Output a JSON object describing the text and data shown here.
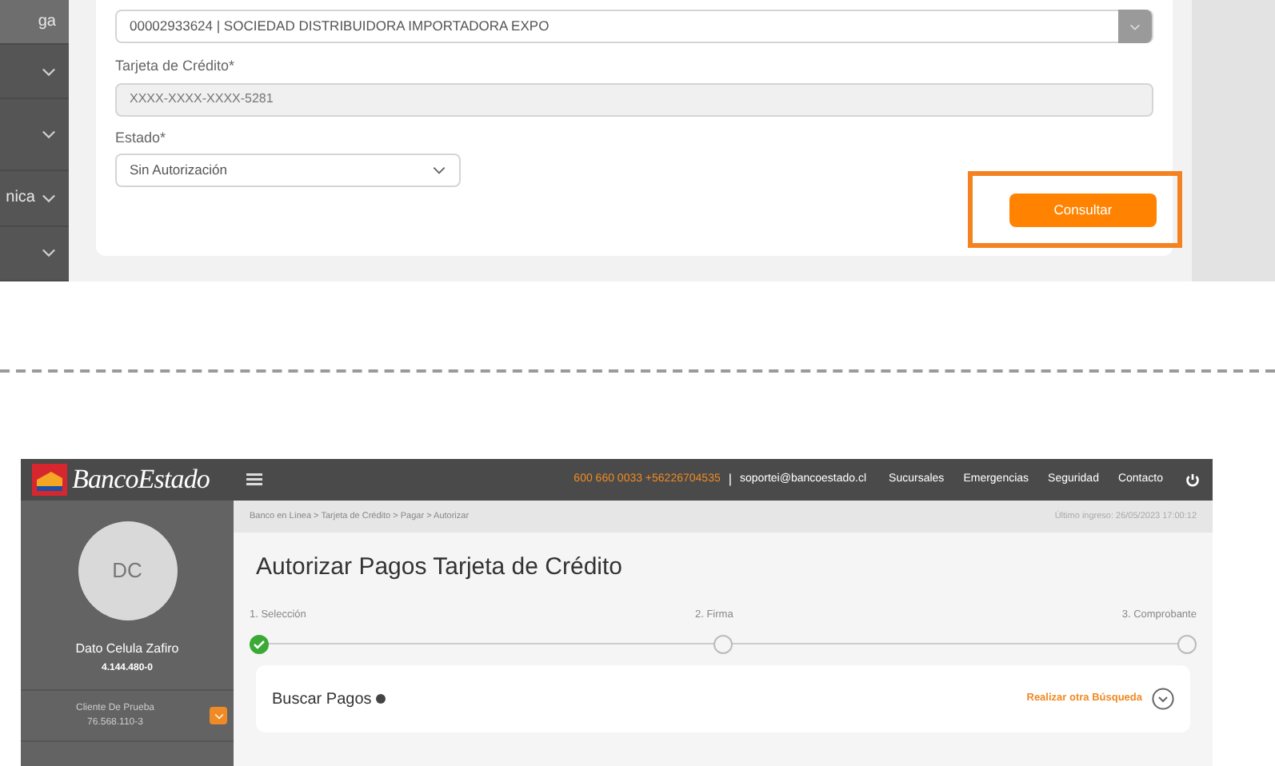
{
  "top_panel": {
    "sidebar_items": [
      {
        "label": "ga",
        "selected": true,
        "expandable": false
      },
      {
        "selected": false,
        "expandable": true
      },
      {
        "selected": false,
        "expandable": true
      },
      {
        "label": "nica",
        "selected": false,
        "expandable": true
      },
      {
        "selected": false,
        "expandable": true
      }
    ],
    "account_select": {
      "value": "00002933624 | SOCIEDAD DISTRIBUIDORA IMPORTADORA EXPO"
    },
    "card_field": {
      "label": "Tarjeta de Crédito*",
      "value": "XXXX-XXXX-XXXX-5281",
      "disabled": true
    },
    "status_select": {
      "label": "Estado*",
      "value": "Sin Autorización"
    },
    "submit_button": {
      "label": "Consultar",
      "highlighted": true
    }
  },
  "bottom_panel": {
    "header": {
      "logo": "BancoEstado",
      "phone": "600 660 0033 +56226704535",
      "separator": "|",
      "email": "soportei@bancoestado.cl",
      "links": [
        "Sucursales",
        "Emergencias",
        "Seguridad",
        "Contacto"
      ]
    },
    "sidebar": {
      "initials": "DC",
      "user_name": "Dato Celula Zafiro",
      "user_rut": "4.144.480-0",
      "client_name": "Cliente De Prueba",
      "client_rut": "76.568.110-3"
    },
    "breadcrumb": "Banco en Línea > Tarjeta de Crédito > Pagar > Autorizar",
    "last_login": "Último ingreso: 26/05/2023 17:00:12",
    "title": "Autorizar Pagos Tarjeta de Crédito",
    "steps": [
      {
        "label": "1. Selección",
        "done": true
      },
      {
        "label": "2. Firma",
        "done": false
      },
      {
        "label": "3. Comprobante",
        "done": false
      }
    ],
    "search_card": {
      "title": "Buscar Pagos",
      "action": "Realizar otra Búsqueda"
    }
  }
}
